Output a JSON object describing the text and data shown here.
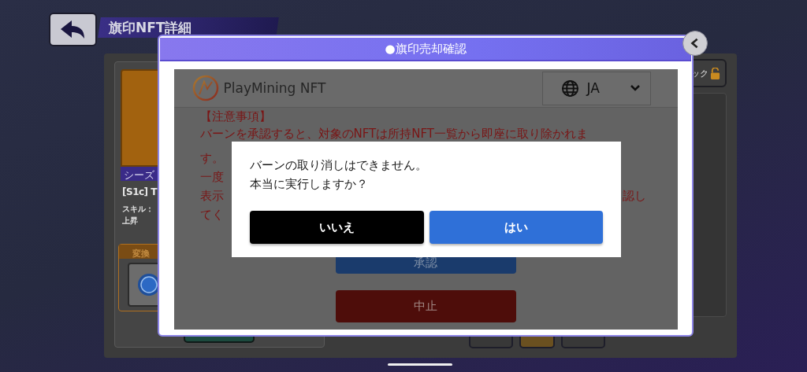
{
  "page": {
    "title": "旗印NFT詳細",
    "card": {
      "season_label": "シーズ",
      "name": "[S1c] T",
      "skill_label": "スキル：",
      "skill_value": "上昇",
      "exchange_label": "変換"
    },
    "lock_button": "ック"
  },
  "modal": {
    "title": "●旗印売却確認",
    "site": {
      "brand": "PlayMining NFT",
      "language": "JA",
      "notice_lines": [
        {
          "text": "【注意事項】"
        },
        {
          "text": "バーンを承認すると、対象のNFTは所持NFT一覧から即座に取り除かれま"
        },
        {
          "text": "す。"
        },
        {
          "text": "一度"
        },
        {
          "text": "表示",
          "tail": "認し"
        },
        {
          "text": "てく"
        }
      ],
      "approve_button": "承認",
      "cancel_button": "中止"
    }
  },
  "dialog": {
    "message_lines": [
      "バーンの取り消しはできません。",
      "本当に実行しますか？"
    ],
    "buttons": [
      {
        "label": "いいえ",
        "kind": "secondary"
      },
      {
        "label": "はい",
        "kind": "primary"
      }
    ]
  }
}
